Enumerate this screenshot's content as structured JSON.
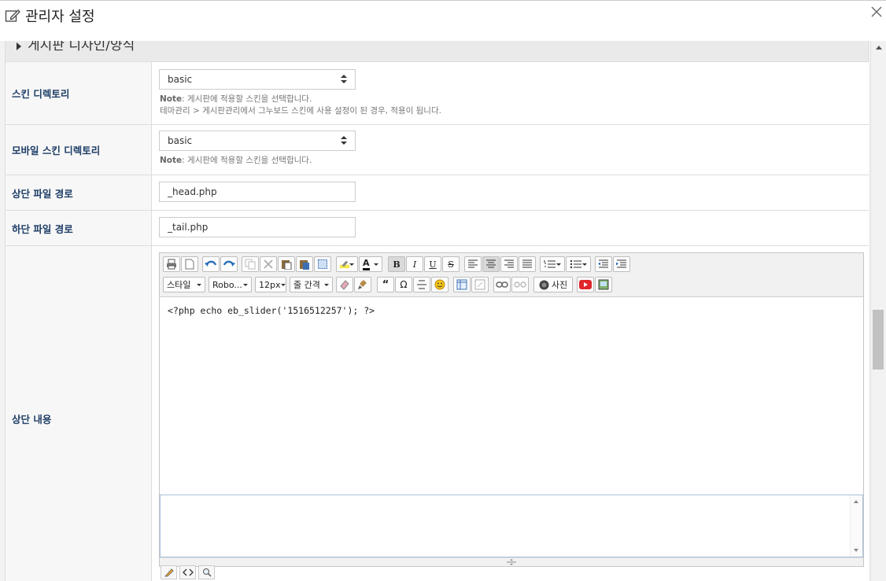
{
  "window": {
    "title": "관리자 설정"
  },
  "section": {
    "title": "게시판 디자인/양식"
  },
  "rows": {
    "skin_dir": {
      "label": "스킨 디렉토리",
      "selected": "basic",
      "note_prefix": "Note",
      "note_line1": ": 게시판에 적용할 스킨을 선택합니다.",
      "note_line2": "테마관리 > 게시판관리에서 그누보드 스킨에 사용 설정이 된 경우, 적용이 됩니다."
    },
    "mobile_skin_dir": {
      "label": "모바일 스킨 디렉토리",
      "selected": "basic",
      "note_prefix": "Note",
      "note_line1": ": 게시판에 적용할 스킨을 선택합니다."
    },
    "head_file": {
      "label": "상단 파일 경로",
      "value": "_head.php"
    },
    "tail_file": {
      "label": "하단 파일 경로",
      "value": "_tail.php"
    },
    "head_content": {
      "label": "상단 내용"
    }
  },
  "editor": {
    "toolbar": {
      "style_label": "스타일",
      "font_label": "Robo...",
      "size_label": "12px",
      "line_spacing_label": "줄 간격",
      "photo_label": "사진",
      "quote_glyph": "“",
      "omega_glyph": "Ω",
      "bold_glyph": "B",
      "italic_glyph": "I",
      "underline_glyph": "U",
      "strike_glyph": "S",
      "color_glyph": "A"
    },
    "content": "<?php echo eb_slider('1516512257'); ?>"
  },
  "colors": {
    "label_text": "#1e3e67",
    "page_bg": "#f2f2f2",
    "youtube_red": "#e0262a",
    "editor_border": "#a8bfdc"
  }
}
